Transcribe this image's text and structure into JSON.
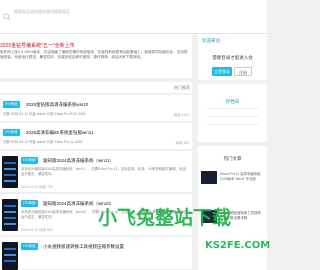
{
  "header": {
    "search_placeholder": "搜索商品或店铺关键词搜索商品"
  },
  "featured": {
    "title": "2025金钻号编系统\"五一\"全新上市",
    "description": "软件网上线2.0.100.0版本，内容涵盖了最新的操作系统版本，在保持系统原有功能基础上，新增多项功能优化，支持快速安装，系统运行稳定，兼容性好，安装完成后即可使用，操作简单，欢迎大家下载体验。"
  },
  "section": {
    "more_label": "热门推荐"
  },
  "items": [
    {
      "badge": "ITN系统",
      "title": "2025金钻版高清非编系统win10",
      "desc": "日期 2025-03-12  作者 admin  分类 Edius Pro 9/10 2025",
      "meta": "阅读 1205"
    },
    {
      "badge": "ITN系统",
      "title": "2025高清非编8K系统金钻版win11",
      "desc": "日期 2025-03-12  作者 admin  分类 Edius Pro 11 2025",
      "meta": "阅读 986"
    },
    {
      "badge": "ITN系统",
      "title": "璇知版2024高清非编系统（win11）",
      "desc": "本系统为璇知版2024高清非编系统（win11），内置Edius Pro 11，支持高清、标清、4K等多种格式编辑，系统运行稳定，兼容性好。",
      "meta": "2024-12-20  阅读 756"
    },
    {
      "badge": "ITN系统",
      "title": "璇知版2024高清非编系统（win10）",
      "desc": "本系统为璇知版2024高清非编系统（win10），内置Edius Pro 10，支持高清、标清、4K等多种格式编辑，系统运行稳定，兼容性好。",
      "meta": "2024-12-18  阅读 689"
    },
    {
      "badge": "ITN系统",
      "title": "小丸视频极速转换工具视频压缩参数设置",
      "desc": "",
      "meta": ""
    }
  ],
  "sidebar": {
    "author_label": "欢迎来访",
    "welcome_text": "需要登录才能进入会",
    "login_button": "立即登录",
    "register_button": "注册",
    "stats_title": "存档归",
    "hot_title": "热门文章",
    "hot_items": [
      {
        "text": "Edius Pro 11 高清非编系统2025版本 Win11 专业版"
      },
      {
        "text": "小丸视频极速转换工具视频压缩参数设置详解"
      }
    ]
  },
  "watermark": {
    "text": "小飞兔整站下载",
    "latin": "KS2FE.COM"
  },
  "colors": {
    "accent": "#23b7e5",
    "featured_title": "#c8102e",
    "link": "#2a8fbd",
    "watermark": "#1fb24a"
  }
}
